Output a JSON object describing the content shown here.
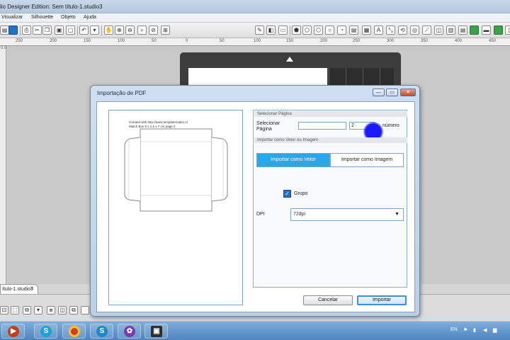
{
  "app": {
    "title": "lio Designer Edition: Sem título-1.studio3"
  },
  "menu": [
    "Visualizar",
    "Silhouette",
    "Objeto",
    "Ajuda"
  ],
  "ruler": {
    "top_ticks": [
      "250",
      "200",
      "150",
      "100",
      "50",
      "0",
      "50",
      "100",
      "150",
      "200",
      "250",
      "300",
      "350",
      "400",
      "450"
    ],
    "left_tick": "0.0"
  },
  "document_tab": {
    "label": "ítulo-1.studio3",
    "close": "x"
  },
  "dialog": {
    "title": "Importação de PDF",
    "preview_text_line1": "Created with http://www.templatemaker.nl",
    "preview_text_line2": "Match Box 5 x 1.5 x 7 cm page 2",
    "page_section": {
      "header": "Selecionar Página",
      "label": "Selecionar Página",
      "page_input_value": "",
      "page_number_value": "2",
      "page_number_label": "número"
    },
    "import_section": {
      "header": "Importar como Vetor ou Imagem",
      "vector_option": "Importar como Vetor",
      "image_option": "Importar como Imagem",
      "selected": "vector"
    },
    "group_checkbox": {
      "label": "Grupo",
      "checked": true
    },
    "dpi": {
      "label": "DPI",
      "value": "72dpi"
    },
    "buttons": {
      "cancel": "Cancelar",
      "import": "Importar"
    },
    "window_buttons": {
      "minimize": "—",
      "maximize": "▭",
      "close": "✕"
    }
  },
  "taskbar": {
    "tray_lang": "EN",
    "apps": [
      "media-player-icon",
      "skype-icon",
      "chrome-icon",
      "silhouette-icon",
      "paint-icon",
      "video-icon"
    ]
  },
  "colors": {
    "accent": "#28a8e8",
    "dialog_frame": "#bad0e8",
    "cursor": "#1a1aff",
    "mat": "#3c3c3c"
  }
}
